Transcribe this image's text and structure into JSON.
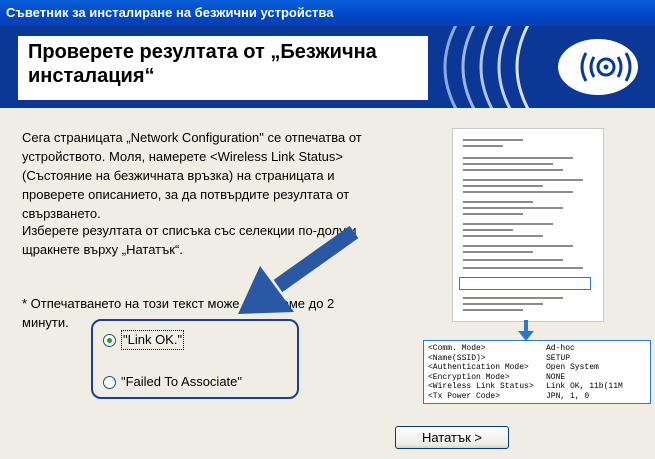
{
  "window": {
    "title": "Съветник за инсталиране на безжични устройства"
  },
  "header": {
    "heading": "Проверете резултата от „Безжична инсталация“"
  },
  "content": {
    "paragraph1": "Сега страницата „Network Configuration\" се отпечатва от устройството. Моля, намерете <Wireless Link Status> (Състояние на безжичната връзка) на страницата и проверете описанието, за да потвърдите резултата от свързването.",
    "paragraph2": "Изберете резултата от списъка със селекции по-долу и щракнете върху „Нататък“.",
    "note": "* Отпечатването на този текст може да отнеме до 2 минути."
  },
  "options": [
    {
      "label": "\"Link OK.\"",
      "selected": true
    },
    {
      "label": "\"Failed To Associate\"",
      "selected": false
    }
  ],
  "config_detail": {
    "rows": [
      {
        "key": "<Comm. Mode>",
        "value": "Ad-hoc"
      },
      {
        "key": "<Name(SSID)>",
        "value": "SETUP"
      },
      {
        "key": "<Authentication Mode>",
        "value": "Open System"
      },
      {
        "key": "<Encryption Mode>",
        "value": "NONE"
      },
      {
        "key": "<Wireless Link Status>",
        "value": "Link OK, 11b(11M"
      },
      {
        "key": "<Tx Power Code>",
        "value": "JPN, 1, 0"
      }
    ]
  },
  "buttons": {
    "next": "Нататък >"
  },
  "colors": {
    "title_bar": "#0054E3",
    "header_bg": "#0B3797",
    "accent_blue": "#2F78C8",
    "option_border": "#1C3F8E",
    "arrow": "#2A58A4"
  },
  "icons": {
    "logo": "wireless-signal-icon",
    "pointer": "pointer-arrow-icon"
  }
}
